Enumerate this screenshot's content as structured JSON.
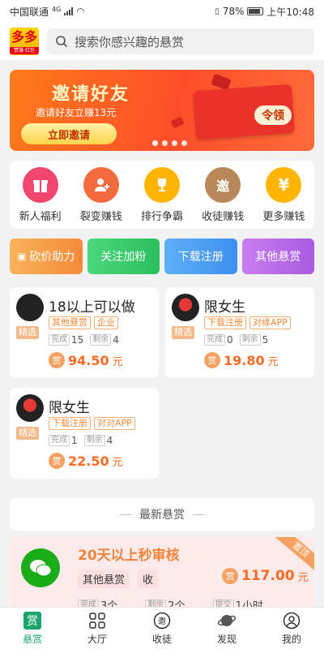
{
  "status_bar": {
    "carrier": "中国联通",
    "network": "4G",
    "battery": "78%",
    "time": "上午10:48"
  },
  "app": {
    "logo_main": "多多",
    "logo_sub": "赞赚·红包",
    "search_placeholder": "搜索你感兴趣的悬赏"
  },
  "banner": {
    "title": "邀请好友",
    "subtitle": "邀请好友立赚13元",
    "button": "立即邀请",
    "envelope_label": "令领",
    "page_indicator": {
      "current": 1,
      "total": 4
    }
  },
  "quick_menu": [
    {
      "label": "新人福利",
      "icon": "gift-icon",
      "color": "#f2456f"
    },
    {
      "label": "裂变赚钱",
      "icon": "user-add-icon",
      "color": "#f26a3d"
    },
    {
      "label": "排行争霸",
      "icon": "trophy-icon",
      "color": "#ffb400"
    },
    {
      "label": "收徒赚钱",
      "icon": "invite-icon",
      "color": "#b8885a"
    },
    {
      "label": "更多赚钱",
      "icon": "yen-icon",
      "color": "#ffb400"
    }
  ],
  "categories": [
    {
      "label": "砍价助力",
      "icon": "gift-icon",
      "color": "#f59a4a"
    },
    {
      "label": "关注加粉",
      "color": "#34c96b"
    },
    {
      "label": "下载注册",
      "color": "#4a9df2"
    },
    {
      "label": "其他悬赏",
      "color": "#b86ae6"
    }
  ],
  "tasks": [
    {
      "title": "18以上可以做",
      "tags": [
        "其他悬赏",
        "企业"
      ],
      "badge": "精选",
      "done_label": "完成",
      "done": "15",
      "left_label": "剩余",
      "left": "4",
      "reward_icon": "赏",
      "amount": "94.50",
      "unit": "元"
    },
    {
      "title": "限女生",
      "tags": [
        "下载注册",
        "对缘APP"
      ],
      "badge": "精选",
      "done_label": "完成",
      "done": "0",
      "left_label": "剩余",
      "left": "5",
      "reward_icon": "赏",
      "amount": "19.80",
      "unit": "元"
    },
    {
      "title": "限女生",
      "tags": [
        "下载注册",
        "对对APP"
      ],
      "badge": "精选",
      "done_label": "完成",
      "done": "1",
      "left_label": "剩余",
      "left": "4",
      "reward_icon": "赏",
      "amount": "22.50",
      "unit": "元"
    }
  ],
  "latest_header": "最新悬赏",
  "latest_task": {
    "title": "20天以上秒审核",
    "tags": [
      "其他悬赏",
      "收"
    ],
    "reward_icon": "赏",
    "amount": "117.00",
    "unit": "元",
    "badge": "置顶",
    "done_label": "完成",
    "done": "3个",
    "left_label": "剩余",
    "left": "2个",
    "submit_label": "提交",
    "submit": "1小时"
  },
  "tabs": [
    {
      "label": "悬赏",
      "icon": "reward-icon",
      "active": true
    },
    {
      "label": "大厅",
      "icon": "grid-icon",
      "active": false
    },
    {
      "label": "收徒",
      "icon": "invite-icon",
      "active": false
    },
    {
      "label": "发现",
      "icon": "planet-icon",
      "active": false
    },
    {
      "label": "我的",
      "icon": "profile-icon",
      "active": false
    }
  ],
  "colors": {
    "accent": "#1aa66a",
    "reward": "#ff6a23",
    "tag": "#f08a3a"
  }
}
